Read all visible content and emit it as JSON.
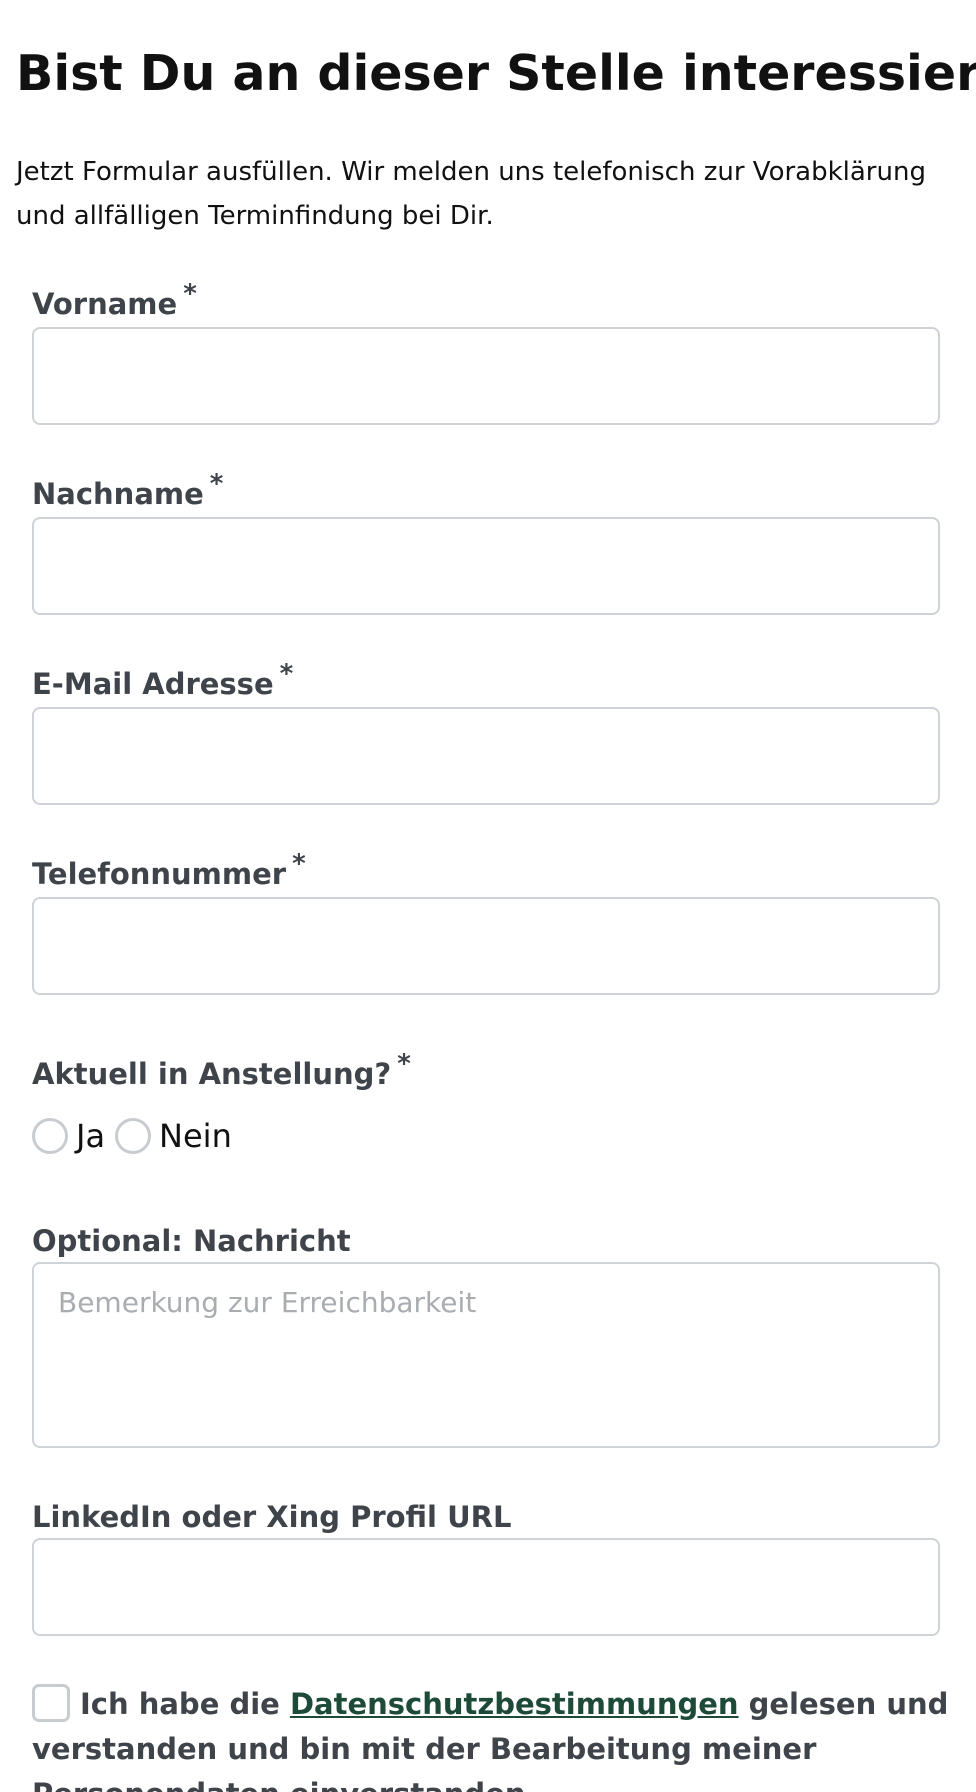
{
  "heading": "Bist Du an dieser Stelle interessiert?",
  "intro": "Jetzt Formular ausfüllen. Wir melden uns telefonisch zur Vorabklärung und allfälligen Terminfindung bei Dir.",
  "required_mark": "*",
  "fields": {
    "vorname": {
      "label": "Vorname",
      "value": ""
    },
    "nachname": {
      "label": "Nachname",
      "value": ""
    },
    "email": {
      "label": "E-Mail Adresse",
      "value": ""
    },
    "telefon": {
      "label": "Telefonnummer",
      "value": ""
    },
    "nachricht": {
      "label": "Optional: Nachricht",
      "placeholder": "Bemerkung zur Erreichbarkeit",
      "value": ""
    },
    "profil_url": {
      "label": "LinkedIn oder Xing Profil URL",
      "value": ""
    }
  },
  "anstellung": {
    "label": "Aktuell in Anstellung?",
    "options": [
      "Ja",
      "Nein"
    ],
    "selected": null
  },
  "consent": {
    "prefix": "Ich habe die ",
    "link": "Datenschutzbestimmungen",
    "suffix": " gelesen und verstanden und bin mit der Bearbeitung meiner Personendaten einverstanden.",
    "checked": false
  },
  "colors": {
    "label": "#3f434a",
    "border": "#cfd2d6",
    "link": "#1e4a38",
    "placeholder": "#a9adb2"
  }
}
